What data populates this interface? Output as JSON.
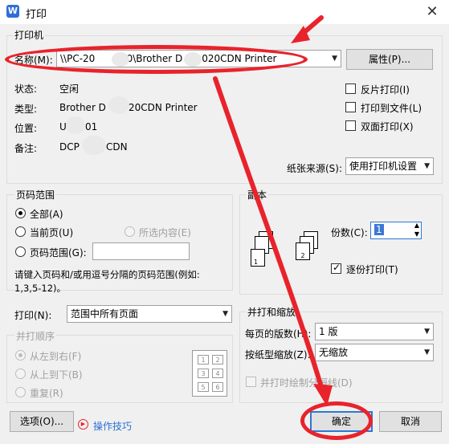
{
  "window": {
    "title": "打印",
    "app_icon_letter": "W",
    "close_glyph": "✕"
  },
  "printer": {
    "group_title": "打印机",
    "name_label": "名称(M):",
    "name_value": "\\\\PC-20",
    "name_value_mid": "020\\Brother D",
    "name_value_end": "020CDN Printer",
    "properties_button": "属性(P)...",
    "status_label": "状态:",
    "status_value": "空闲",
    "type_label": "类型:",
    "type_value_a": "Brother D",
    "type_value_b": "20CDN Printer",
    "location_label": "位置:",
    "location_value_a": "U",
    "location_value_b": "01",
    "comment_label": "备注:",
    "comment_value_a": "DCP",
    "comment_value_b": "CDN",
    "reverse_print": "反片打印(I)",
    "print_to_file": "打印到文件(L)",
    "duplex": "双面打印(X)",
    "paper_source_label": "纸张来源(S):",
    "paper_source_value": "使用打印机设置"
  },
  "page_range": {
    "group_title": "页码范围",
    "all": "全部(A)",
    "current": "当前页(U)",
    "selection": "所选内容(E)",
    "pages": "页码范围(G):",
    "hint_line1": "请键入页码和/或用逗号分隔的页码范围(例如:",
    "hint_line2": "1,3,5-12)。"
  },
  "copies": {
    "group_title": "副本",
    "count_label": "份数(C):",
    "count_value": "1",
    "collate": "逐份打印(T)",
    "page_numbers": [
      "1",
      "2",
      "3"
    ]
  },
  "print_what": {
    "label": "打印(N):",
    "value": "范围中所有页面"
  },
  "order": {
    "group_title": "并打顺序",
    "left_to_right": "从左到右(F)",
    "top_to_bottom": "从上到下(B)",
    "repeat": "重复(R)",
    "grid": [
      "1",
      "2",
      "3",
      "4",
      "5",
      "6"
    ]
  },
  "scaling": {
    "group_title": "并打和缩放",
    "pages_per_sheet_label": "每页的版数(H):",
    "pages_per_sheet_value": "1 版",
    "scale_label": "按纸型缩放(Z):",
    "scale_value": "无缩放",
    "draw_borders": "并打时绘制分隔线(D)"
  },
  "footer": {
    "options_button": "选项(O)...",
    "tips_link": "操作技巧",
    "ok_button": "确定",
    "cancel_button": "取消"
  },
  "annotations": {
    "color": "#e8232b"
  }
}
